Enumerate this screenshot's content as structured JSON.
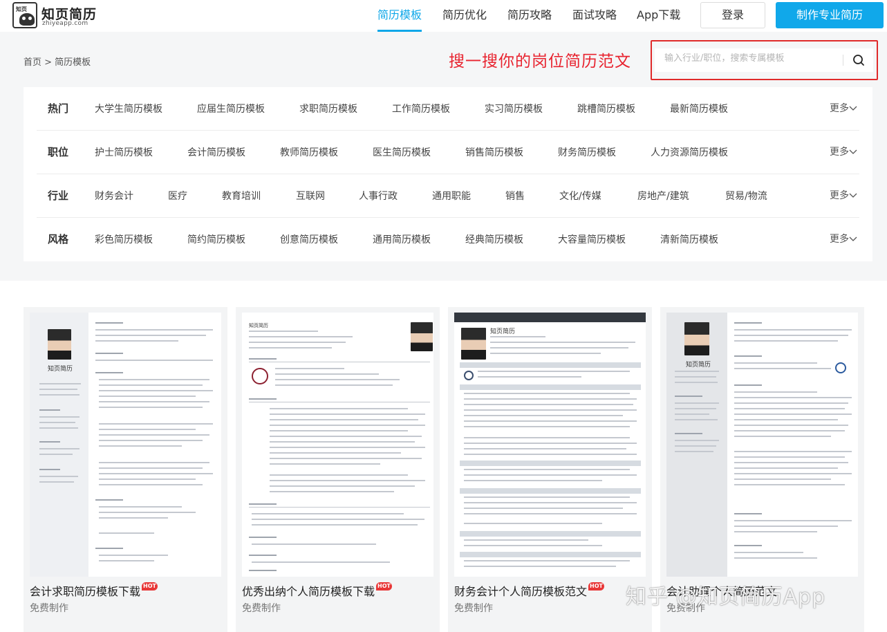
{
  "header": {
    "logo_mark": "知页",
    "logo_name": "知页简历",
    "logo_domain": "zhiyeapp.com",
    "nav": [
      "简历模板",
      "简历优化",
      "简历攻略",
      "面试攻略",
      "App下载"
    ],
    "login_label": "登录",
    "make_label": "制作专业简历"
  },
  "breadcrumb": "首页 > 简历模板",
  "promo_text": "搜一搜你的岗位简历范文",
  "search": {
    "placeholder": "输入行业/职位，搜索专属模板",
    "icon": "search-icon"
  },
  "filters": [
    {
      "title": "热门",
      "items": [
        "大学生简历模板",
        "应届生简历模板",
        "求职简历模板",
        "工作简历模板",
        "实习简历模板",
        "跳槽简历模板",
        "最新简历模板"
      ],
      "more": "更多"
    },
    {
      "title": "职位",
      "items": [
        "护士简历模板",
        "会计简历模板",
        "教师简历模板",
        "医生简历模板",
        "销售简历模板",
        "财务简历模板",
        "人力资源简历模板"
      ],
      "more": "更多"
    },
    {
      "title": "行业",
      "items": [
        "财务会计",
        "医疗",
        "教育培训",
        "互联网",
        "人事行政",
        "通用职能",
        "销售",
        "文化/传媒",
        "房地产/建筑",
        "贸易/物流"
      ],
      "more": "更多"
    },
    {
      "title": "风格",
      "items": [
        "彩色简历模板",
        "简约简历模板",
        "创意简历模板",
        "通用简历模板",
        "经典简历模板",
        "大容量简历模板",
        "清新简历模板"
      ],
      "more": "更多"
    }
  ],
  "cards": [
    {
      "title": "会计求职简历模板下载",
      "badge": "HOT",
      "sub": "免费制作",
      "resume_name": "知页简历"
    },
    {
      "title": "优秀出纳个人简历模板下载",
      "badge": "HOT",
      "sub": "免费制作",
      "resume_name": "知页简历"
    },
    {
      "title": "财务会计个人简历模板范文",
      "badge": "HOT",
      "sub": "免费制作",
      "resume_name": "知页简历"
    },
    {
      "title": "会计助理个人简历范文",
      "badge": "",
      "sub": "免费制作",
      "resume_name": "知页简历"
    }
  ],
  "watermark": "知乎 @知页简历App",
  "colors": {
    "accent": "#10a8ea",
    "promo_red": "#e8232f",
    "hot": "#e83737"
  }
}
